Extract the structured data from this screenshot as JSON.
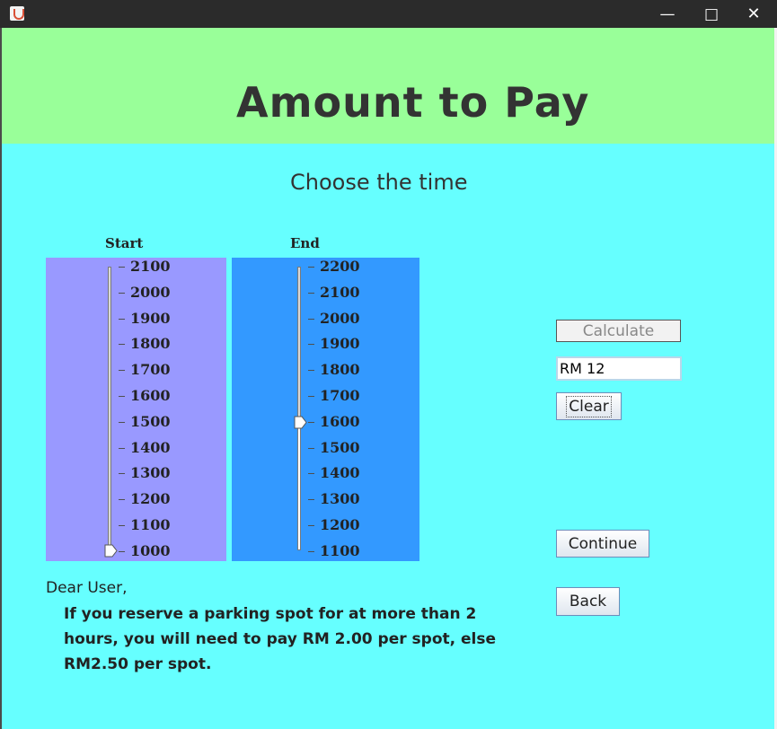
{
  "window": {
    "minimize_glyph": "—",
    "maximize_glyph": "□",
    "close_glyph": "✕"
  },
  "header": {
    "title": "Amount to Pay"
  },
  "main": {
    "subtitle": "Choose the time",
    "start_slider": {
      "label": "Start",
      "ticks": [
        "2100",
        "2000",
        "1900",
        "1800",
        "1700",
        "1600",
        "1500",
        "1400",
        "1300",
        "1200",
        "1100",
        "1000"
      ],
      "value": 1000
    },
    "end_slider": {
      "label": "End",
      "ticks": [
        "2200",
        "2100",
        "2000",
        "1900",
        "1800",
        "1700",
        "1600",
        "1500",
        "1400",
        "1300",
        "1200",
        "1100"
      ],
      "value": 1600
    },
    "calculate_label": "Calculate",
    "result_value": "RM 12",
    "clear_label": "Clear",
    "continue_label": "Continue",
    "back_label": "Back",
    "dear_text": "Dear User,",
    "message": "If you reserve a parking spot for at more than 2 hours, you will need to pay RM 2.00 per spot, else RM2.50 per spot."
  },
  "colors": {
    "header_bg": "#99ff99",
    "content_bg": "#66ffff",
    "start_panel_bg": "#9999ff",
    "end_panel_bg": "#3399ff"
  },
  "icons": {
    "app": "java-app-icon",
    "minimize": "minimize-icon",
    "maximize": "maximize-icon",
    "close": "close-icon",
    "slider_thumb": "slider-thumb-icon"
  }
}
